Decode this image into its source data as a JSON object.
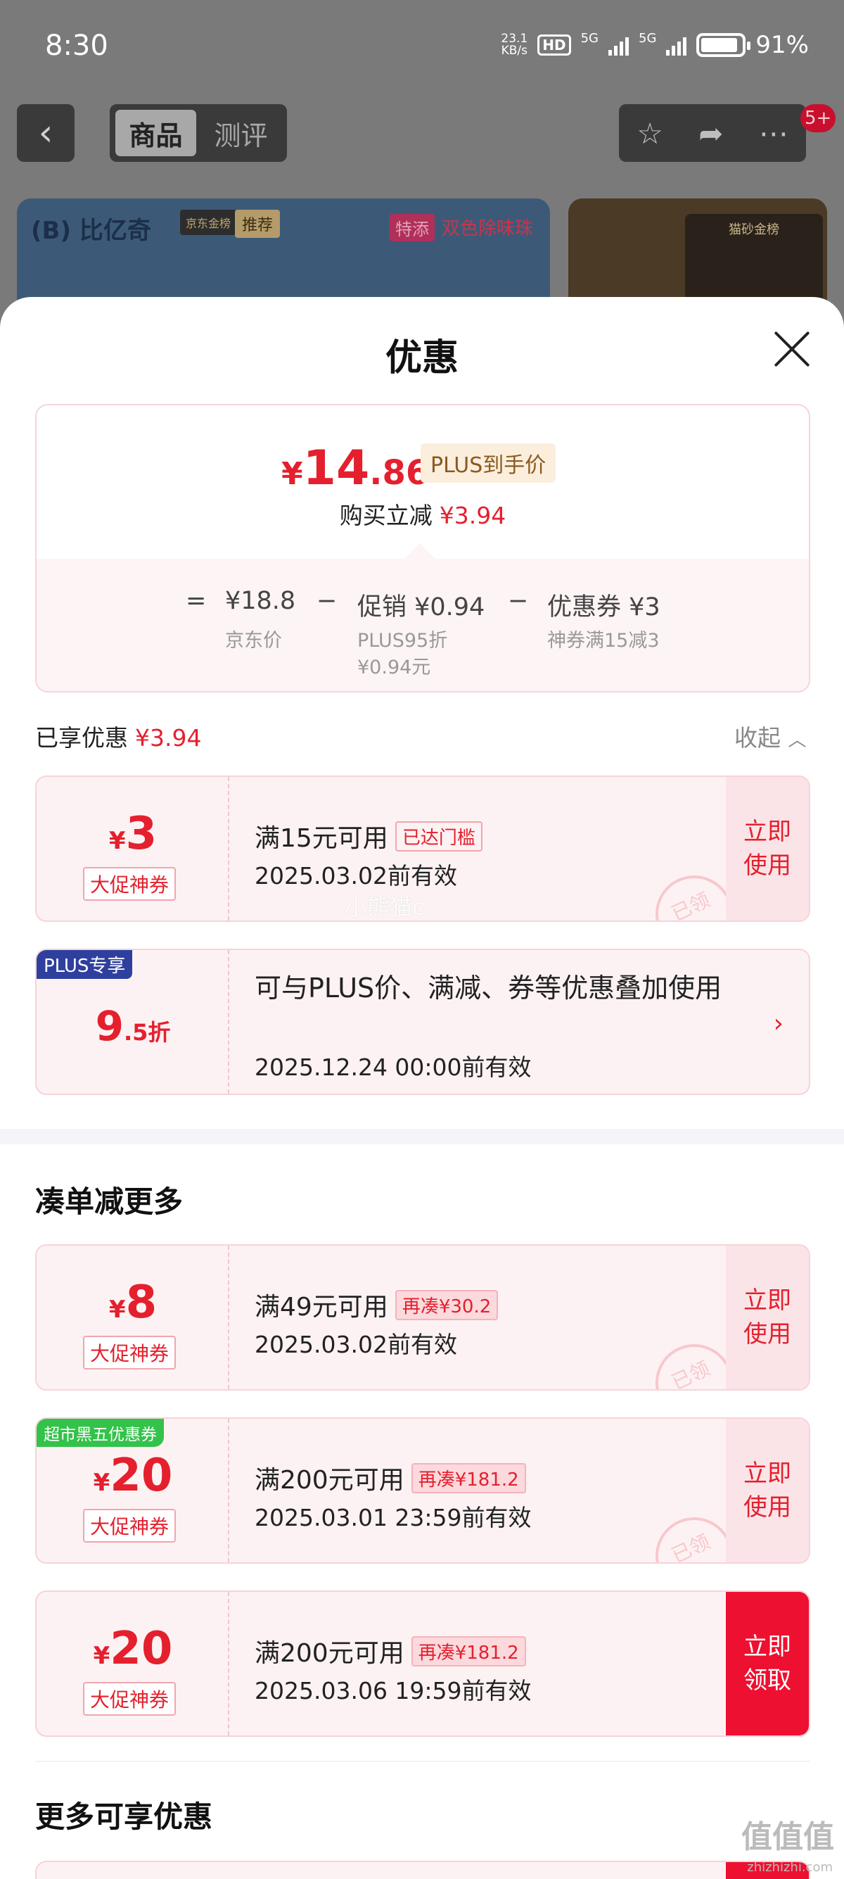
{
  "status_bar": {
    "time": "8:30",
    "net_speed_value": "23.1",
    "net_speed_unit": "KB/s",
    "hd": "HD",
    "sim1": "5G",
    "sim2": "5G",
    "battery_level": 0.91,
    "battery_text": "91%"
  },
  "app_header": {
    "back_icon": "chevron-left-icon",
    "tabs": [
      {
        "label": "商品",
        "active": true
      },
      {
        "label": "测评",
        "active": false
      }
    ],
    "message_badge": "5+"
  },
  "banner": {
    "brand": "(B) 比亿奇",
    "jd_tag": "京东金榜",
    "recommend": "推荐",
    "special": "特添",
    "subtitle": "双色除味珠",
    "card_text": "猫砂金榜"
  },
  "sheet": {
    "title": "优惠",
    "summary": {
      "final_price_symbol": "¥",
      "final_price_int": "14",
      "final_price_dec": ".86",
      "price_tag": "PLUS到手价",
      "reduce_label": "购买立减",
      "reduce_amount": "¥3.94",
      "formula": {
        "equals": "=",
        "jd_price": "¥18.8",
        "jd_price_label": "京东价",
        "minus1": "−",
        "promo": "促销 ¥0.94",
        "promo_sub1": "PLUS95折",
        "promo_sub2": "¥0.94元",
        "minus2": "−",
        "coupon": "优惠券 ¥3",
        "coupon_sub": "神券满15减3"
      }
    },
    "enjoyed": {
      "label": "已享优惠",
      "amount": "¥3.94",
      "collapse": "收起"
    },
    "applied": [
      {
        "symbol": "¥",
        "amount": "3",
        "type": "大促神券",
        "condition": "满15元可用",
        "tag": "已达门槛",
        "valid": "2025.03.02前有效",
        "action": "立即使用",
        "stamp": "已领"
      },
      {
        "ribbon": "PLUS专享",
        "discount_big": "9",
        "discount_small": ".5折",
        "desc": "可与PLUS价、满减、券等优惠叠加使用",
        "valid": "2025.12.24 00:00前有效"
      }
    ],
    "more_section_title": "凑单减更多",
    "more_coupons": [
      {
        "symbol": "¥",
        "amount": "8",
        "type": "大促神券",
        "condition": "满49元可用",
        "tag": "再凑¥30.2",
        "valid": "2025.03.02前有效",
        "action": "立即使用",
        "stamp": "已领"
      },
      {
        "ribbon": "超市黑五优惠券",
        "symbol": "¥",
        "amount": "20",
        "type": "大促神券",
        "condition": "满200元可用",
        "tag": "再凑¥181.2",
        "valid": "2025.03.01 23:59前有效",
        "action": "立即使用",
        "stamp": "已领"
      },
      {
        "symbol": "¥",
        "amount": "20",
        "type": "大促神券",
        "condition": "满200元可用",
        "tag": "再凑¥181.2",
        "valid": "2025.03.06 19:59前有效",
        "action": "立即领取"
      }
    ],
    "enjoy_section_title": "更多可享优惠"
  },
  "watermark": "小熊猫c",
  "site_mark": "值值值",
  "site_url": "zhizhizhi.com"
}
